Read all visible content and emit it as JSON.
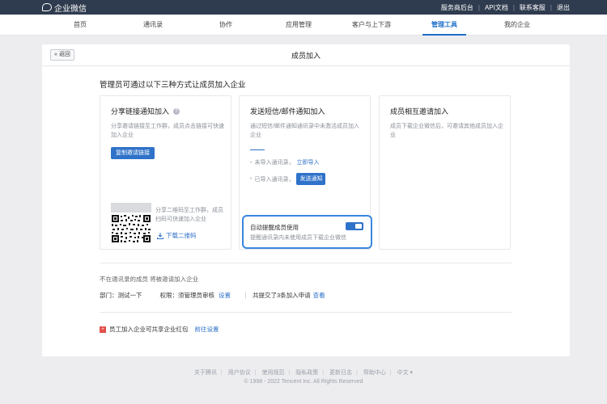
{
  "topbar": {
    "brand": "企业微信",
    "links": [
      "服务商后台",
      "API文档",
      "联系客服",
      "退出"
    ]
  },
  "nav": {
    "items": [
      "首页",
      "通讯录",
      "协作",
      "应用管理",
      "客户与上下游",
      "管理工具",
      "我的企业"
    ],
    "active": "管理工具"
  },
  "card": {
    "back_label": "« 返回",
    "title": "成员加入",
    "intro": "管理员可通过以下三种方式让成员加入企业"
  },
  "panel_share": {
    "title": "分享链接通知加入",
    "help_icon": "?",
    "desc": "分享邀请链接至工作群，成员点击链接可快速加入企业",
    "copy_button": "复制邀请链接",
    "qr_desc": "分享二维码至工作群，成员扫码可快速加入企业",
    "download_label": "下载二维码"
  },
  "panel_sms": {
    "title": "发送短信/邮件通知加入",
    "desc": "通过短信/邮件通知通讯录中未激活成员加入企业",
    "step1_text": "未导入通讯录，",
    "step1_link": "立即导入",
    "step2_text": "已导入通讯录，",
    "step2_button": "发送通知",
    "remind_title": "自动提醒成员使用",
    "remind_desc": "提醒通讯录内未使用成员下载企业微信",
    "remind_enabled": true
  },
  "panel_invite": {
    "title": "成员相互邀请加入",
    "desc": "成员下载企业微信后，可邀请其他成员加入企业"
  },
  "invite_settings": {
    "note": "不在通讯录的成员 将被邀请加入企业",
    "dept_label": "部门：",
    "dept_value": "测试一下",
    "perm_label": "权限：",
    "perm_value": "须管理员审核",
    "perm_link": "设置",
    "submitted_text": "共提交了3条加入申请",
    "submitted_link": "查看"
  },
  "promo": {
    "icon": "+",
    "text": "员工加入企业可共享企业红包",
    "link": "前往设置"
  },
  "footer": {
    "links": [
      "关于腾讯",
      "用户协议",
      "使用规范",
      "隐私政策",
      "更新日志",
      "帮助中心",
      "中文 ▾"
    ],
    "copyright": "© 1998 - 2022 Tencent Inc. All Rights Reserved"
  },
  "colors": {
    "header": "#2f3b4e",
    "accent": "#2f72c9",
    "highlight_border": "#3a86e0",
    "promo_icon": "#e2504a"
  }
}
